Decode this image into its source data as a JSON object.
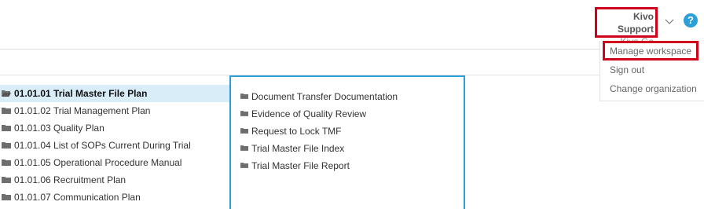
{
  "header": {
    "user_name": "Kivo Support",
    "org_name": "Kivo Go",
    "help_glyph": "?"
  },
  "user_menu": {
    "items": [
      {
        "label": "Manage workspace"
      },
      {
        "label": "Sign out"
      },
      {
        "label": "Change organization"
      }
    ]
  },
  "tree": {
    "items": [
      {
        "label": "01.01.01 Trial Master File Plan",
        "selected": true,
        "icon": "folder-open-icon"
      },
      {
        "label": "01.01.02 Trial Management Plan",
        "icon": "folder-icon"
      },
      {
        "label": "01.01.03 Quality Plan",
        "icon": "folder-icon"
      },
      {
        "label": "01.01.04 List of SOPs Current During Trial",
        "icon": "folder-icon"
      },
      {
        "label": "01.01.05 Operational Procedure Manual",
        "icon": "folder-icon"
      },
      {
        "label": "01.01.06 Recruitment Plan",
        "icon": "folder-icon"
      },
      {
        "label": "01.01.07 Communication Plan",
        "icon": "folder-icon"
      }
    ]
  },
  "panel": {
    "items": [
      {
        "label": "Document Transfer Documentation",
        "icon": "folder-icon"
      },
      {
        "label": "Evidence of Quality Review",
        "icon": "folder-icon"
      },
      {
        "label": "Request to Lock TMF",
        "icon": "folder-icon"
      },
      {
        "label": "Trial Master File Index",
        "icon": "folder-icon"
      },
      {
        "label": "Trial Master File Report",
        "icon": "folder-icon"
      }
    ]
  },
  "colors": {
    "accent": "#2a9fd8",
    "highlight_border": "#d0021b",
    "selected_row": "#d9edf9"
  }
}
